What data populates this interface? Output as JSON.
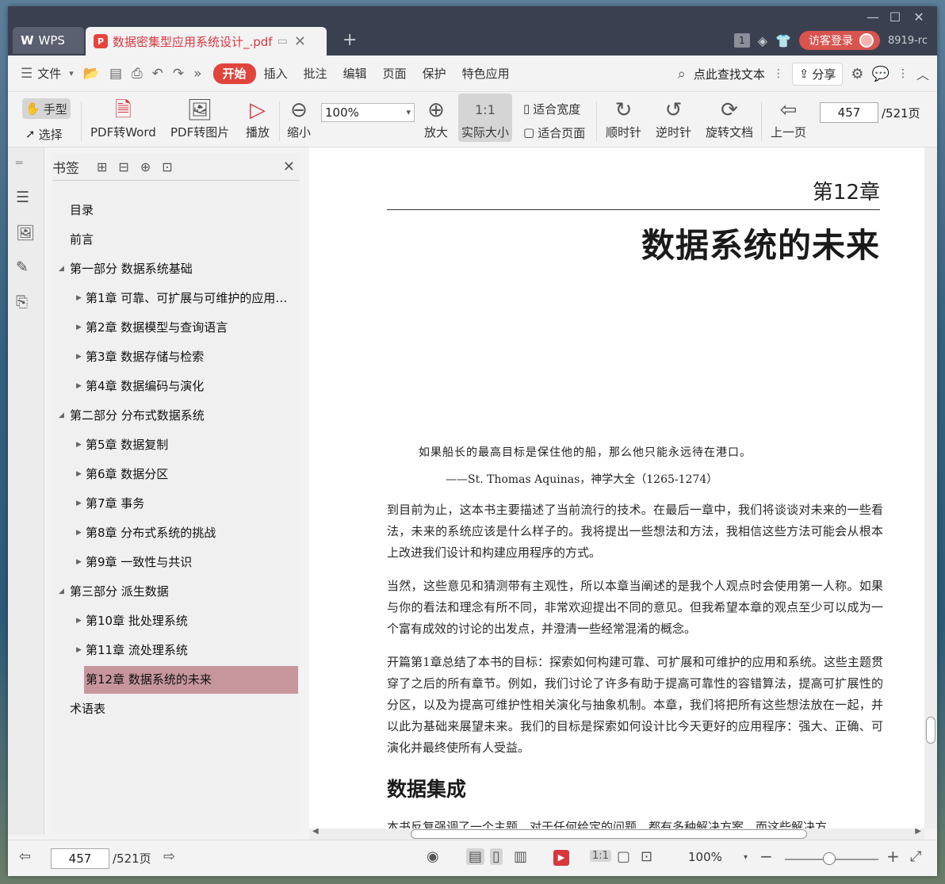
{
  "titlebar": {
    "app_tab": "WPS",
    "doc_tab": "数据密集型应用系统设计_.pdf",
    "page_badge": "1",
    "login": "访客登录",
    "user_id": "8919-rc"
  },
  "menu": {
    "file": "文件",
    "items": [
      "开始",
      "插入",
      "批注",
      "编辑",
      "页面",
      "保护",
      "特色应用"
    ],
    "search": "点此查找文本",
    "share": "分享"
  },
  "toolbar": {
    "hand": "手型",
    "select": "选择",
    "pdf_to_word": "PDF转Word",
    "pdf_to_image": "PDF转图片",
    "play": "播放",
    "zoom_out": "缩小",
    "zoom_value": "100%",
    "zoom_in": "放大",
    "actual_size": "实际大小",
    "fit_width": "适合宽度",
    "fit_page": "适合页面",
    "clockwise": "顺时针",
    "counterclockwise": "逆时针",
    "rotate_doc": "旋转文档",
    "prev_page": "上一页",
    "page_current": "457",
    "page_total": "/521页"
  },
  "panel": {
    "title": "书签",
    "items": [
      {
        "label": "目录"
      },
      {
        "label": "前言"
      },
      {
        "label": "第一部分 数据系统基础"
      },
      {
        "label": "第1章 可靠、可扩展与可维护的应用系..."
      },
      {
        "label": "第2章 数据模型与查询语言"
      },
      {
        "label": "第3章 数据存储与检索"
      },
      {
        "label": "第4章 数据编码与演化"
      },
      {
        "label": "第二部分 分布式数据系统"
      },
      {
        "label": "第5章 数据复制"
      },
      {
        "label": "第6章 数据分区"
      },
      {
        "label": "第7章 事务"
      },
      {
        "label": "第8章 分布式系统的挑战"
      },
      {
        "label": "第9章 一致性与共识"
      },
      {
        "label": "第三部分 派生数据"
      },
      {
        "label": "第10章 批处理系统"
      },
      {
        "label": "第11章 流处理系统"
      },
      {
        "label": "第12章 数据系统的未来"
      },
      {
        "label": "术语表"
      }
    ]
  },
  "document": {
    "chapter_number": "第12章",
    "chapter_title": "数据系统的未来",
    "quote": "如果船长的最高目标是保住他的船，那么他只能永远待在港口。",
    "quote_source": "——St. Thomas Aquinas，神学大全（1265-1274）",
    "paragraphs": [
      "到目前为止，这本书主要描述了当前流行的技术。在最后一章中，我们将谈谈对未来的一些看法，未来的系统应该是什么样子的。我将提出一些想法和方法，我相信这些方法可能会从根本上改进我们设计和构建应用程序的方式。",
      "当然，这些意见和猜测带有主观性，所以本章当阐述的是我个人观点时会使用第一人称。如果与你的看法和理念有所不同，非常欢迎提出不同的意见。但我希望本章的观点至少可以成为一个富有成效的讨论的出发点，并澄清一些经常混淆的概念。",
      "开篇第1章总结了本书的目标：探索如何构建可靠、可扩展和可维护的应用和系统。这些主题贯穿了之后的所有章节。例如，我们讨论了许多有助于提高可靠性的容错算法，提高可扩展性的分区，以及为提高可维护性相关演化与抽象机制。本章，我们将把所有这些想法放在一起，并以此为基础来展望未来。我们的目标是探索如何设计比今天更好的应用程序：强大、正确、可演化并最终使所有人受益。"
    ],
    "section_heading": "数据集成",
    "cut_line": "本书反复强调了一个主题，对于任何给定的问题，都有多种解决方案，而这些解决方"
  },
  "statusbar": {
    "page_current": "457",
    "page_total": "/521页",
    "zoom": "100%"
  }
}
